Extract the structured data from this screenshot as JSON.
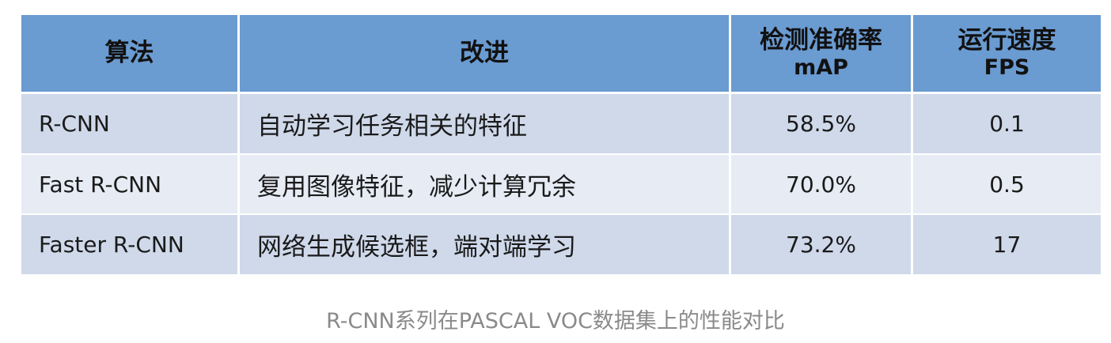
{
  "table": {
    "headers": {
      "algorithm": "算法",
      "improvement": "改进",
      "accuracy_line1": "检测准确率",
      "accuracy_line2": "mAP",
      "speed_line1": "运行速度",
      "speed_line2": "FPS"
    },
    "rows": [
      {
        "algorithm": "R-CNN",
        "improvement": "自动学习任务相关的特征",
        "map": "58.5%",
        "fps": "0.1"
      },
      {
        "algorithm": "Fast R-CNN",
        "improvement": "复用图像特征，减少计算冗余",
        "map": "70.0%",
        "fps": "0.5"
      },
      {
        "algorithm": "Faster R-CNN",
        "improvement": "网络生成候选框，端对端学习",
        "map": "73.2%",
        "fps": "17"
      }
    ],
    "colors": {
      "header_bg": "#6a9bd1",
      "row_odd_bg": "#cfd9ea",
      "row_even_bg": "#e6ebf4"
    }
  },
  "caption": "R-CNN系列在PASCAL VOC数据集上的性能对比"
}
